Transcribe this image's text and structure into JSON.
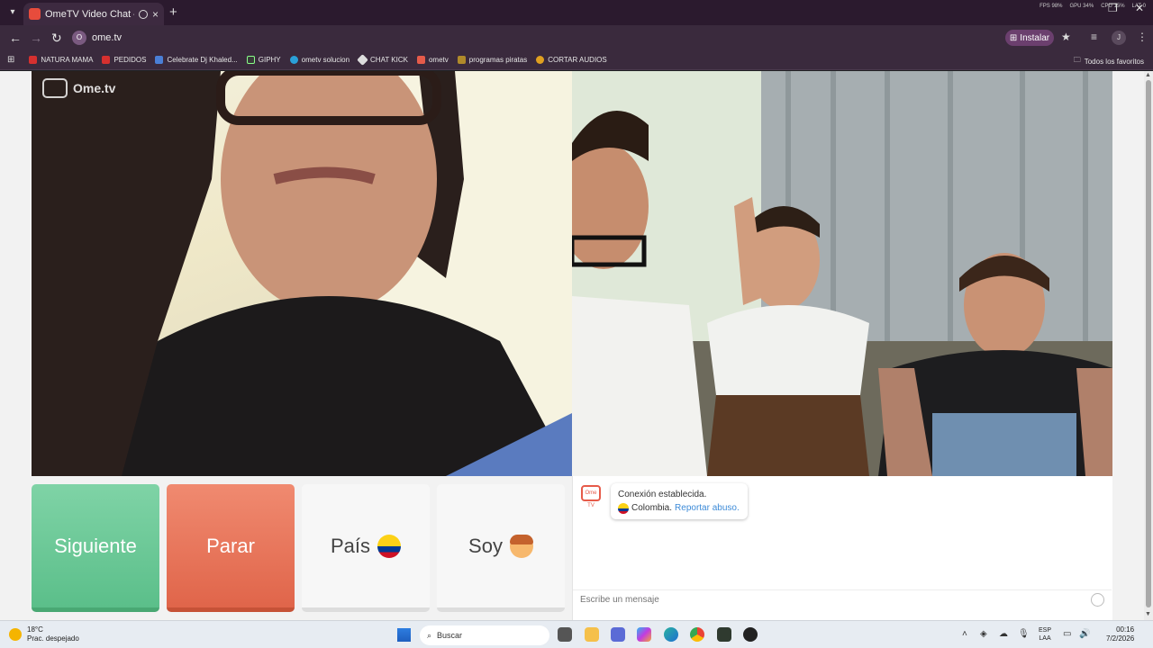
{
  "browser": {
    "tab": {
      "title": "OmeTV Video Chat — Ome",
      "close": "×"
    },
    "new_tab": "+",
    "url": "ome.tv",
    "site_icon": "O",
    "install_label": "Instalar",
    "profile_initial": "J",
    "sys_stats": [
      "FPS 98%",
      "GPU 34%",
      "CPU 15%",
      "LAT 0"
    ],
    "bookmarks": [
      {
        "label": "NATURA MAMA",
        "color": "#d6302f"
      },
      {
        "label": "PEDIDOS",
        "color": "#d6302f"
      },
      {
        "label": "Celebrate Dj Khaled...",
        "color": "#4a7fd6"
      },
      {
        "label": "GIPHY",
        "color": "#3a3a3a"
      },
      {
        "label": "ometv solucion",
        "color": "#2aa0d8"
      },
      {
        "label": "CHAT KICK",
        "color": "#2f2f2f"
      },
      {
        "label": "ometv",
        "color": "#e65b4a"
      },
      {
        "label": "programas piratas",
        "color": "#b08a2a"
      },
      {
        "label": "CORTAR AUDIOS",
        "color": "#e0a020"
      }
    ],
    "all_bookmarks": "Todos los favoritos"
  },
  "site": {
    "logo_text": "Ome.tv",
    "buttons": {
      "next": "Siguiente",
      "stop": "Parar",
      "country": "País",
      "gender": "Soy"
    },
    "chat": {
      "avatar_label": "Ome TV",
      "connection": "Conexión establecida.",
      "country": "Colombia.",
      "report": "Reportar abuso.",
      "input_placeholder": "Escribe un mensaje"
    }
  },
  "taskbar": {
    "weather_temp": "18°C",
    "weather_desc": "Prac. despejado",
    "search_label": "Buscar",
    "lang_top": "ESP",
    "lang_bottom": "LAA",
    "time": "00:16",
    "date": "7/2/2026"
  },
  "colors": {
    "next_button": "#6cc997",
    "stop_button": "#e8735a",
    "chrome_bg": "#3a2a3d",
    "report_link": "#3d8bd8"
  }
}
